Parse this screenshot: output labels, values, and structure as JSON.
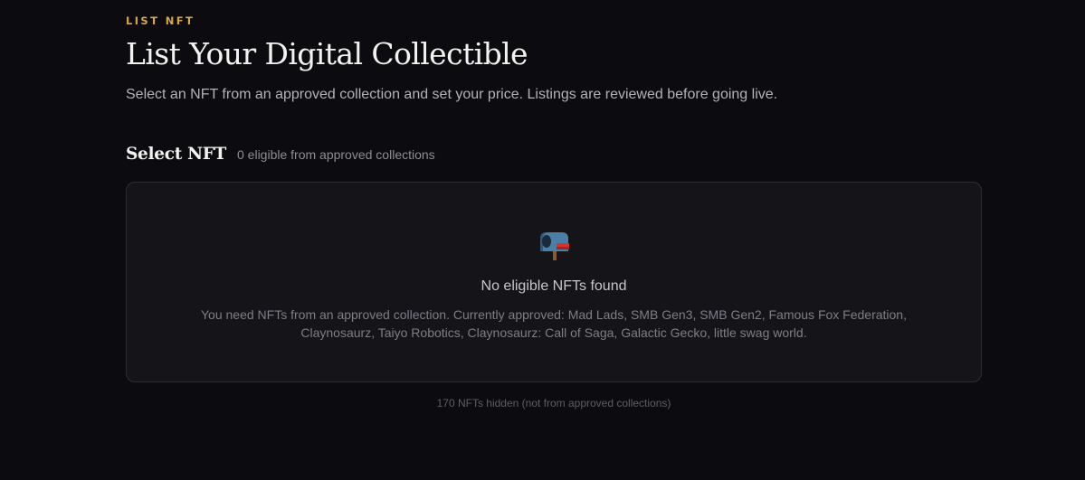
{
  "header": {
    "eyebrow": "LIST NFT",
    "title": "List Your Digital Collectible",
    "subtitle": "Select an NFT from an approved collection and set your price. Listings are reviewed before going live."
  },
  "select_section": {
    "title": "Select NFT",
    "count_text": "0 eligible from approved collections"
  },
  "empty_state": {
    "icon": "mailbox-icon",
    "title": "No eligible NFTs found",
    "description_line1": "You need NFTs from an approved collection. Currently approved: Mad Lads, SMB Gen3, SMB Gen2, Famous Fox Federation,",
    "description_line2": "Claynosaurz, Taiyo Robotics, Claynosaurz: Call of Saga, Galactic Gecko, little swag world."
  },
  "footer_note": "170 NFTs hidden (not from approved collections)",
  "colors": {
    "background": "#0c0b0f",
    "accent": "#d4a84e",
    "card_background": "#151419",
    "card_border": "#2d2c33"
  }
}
